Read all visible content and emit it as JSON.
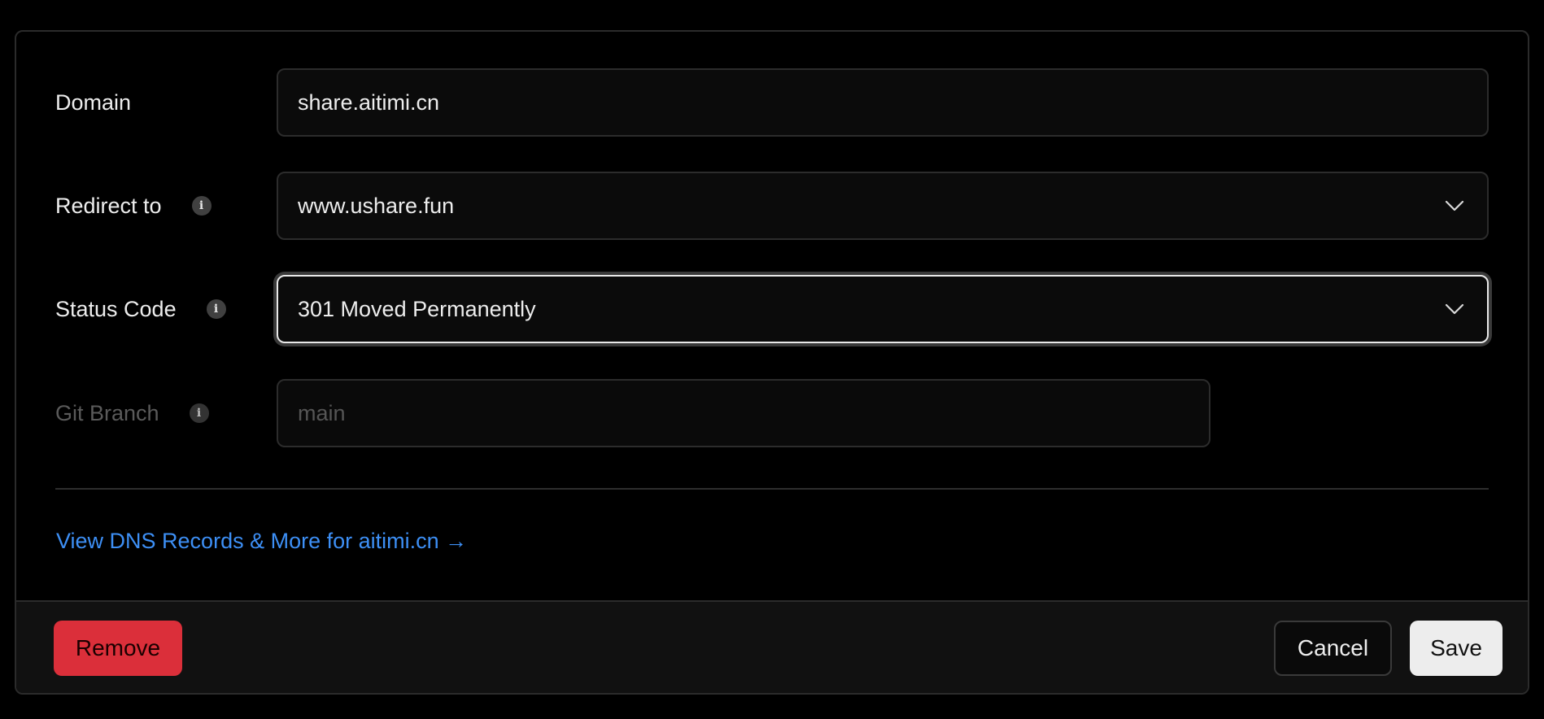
{
  "form": {
    "domain": {
      "label": "Domain",
      "value": "share.aitimi.cn"
    },
    "redirect": {
      "label": "Redirect to",
      "value": "www.ushare.fun",
      "info_icon": "i"
    },
    "status": {
      "label": "Status Code",
      "value": "301 Moved Permanently",
      "info_icon": "i"
    },
    "branch": {
      "label": "Git Branch",
      "placeholder": "main",
      "info_icon": "i"
    }
  },
  "dns_link": "View DNS Records & More for aitimi.cn →",
  "footer": {
    "remove_label": "Remove",
    "cancel_label": "Cancel",
    "save_label": "Save"
  },
  "colors": {
    "link": "#3d8ff5",
    "danger": "#db2f3a",
    "primary": "#ededed",
    "background": "#000000"
  }
}
